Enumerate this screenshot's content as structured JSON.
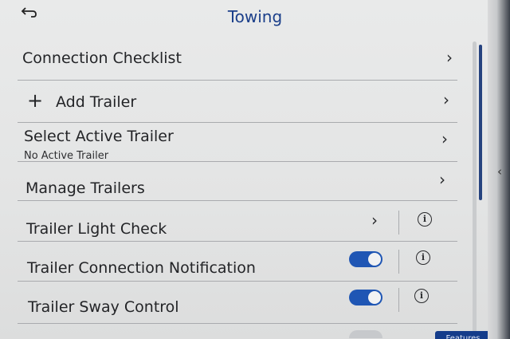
{
  "header": {
    "title": "Towing",
    "back_icon": "back-arrow-icon"
  },
  "rows": [
    {
      "label": "Connection Checklist",
      "control": "chevron"
    },
    {
      "label": "Add Trailer",
      "prefix_icon": "plus-icon",
      "control": "chevron"
    },
    {
      "label": "Select Active Trailer",
      "sublabel": "No Active Trailer",
      "control": "chevron"
    },
    {
      "label": "Manage Trailers",
      "control": "chevron"
    },
    {
      "label": "Trailer Light Check",
      "control": "chevron+info"
    },
    {
      "label": "Trailer Connection Notification",
      "control": "toggle+info",
      "toggle_on": true
    },
    {
      "label": "Trailer Sway Control",
      "control": "toggle+info",
      "toggle_on": true
    }
  ],
  "bottom_tab": {
    "label": "Features"
  },
  "colors": {
    "accent": "#1f56b4",
    "title": "#1b3f8a",
    "screen_bg": "#e6e7e7"
  }
}
